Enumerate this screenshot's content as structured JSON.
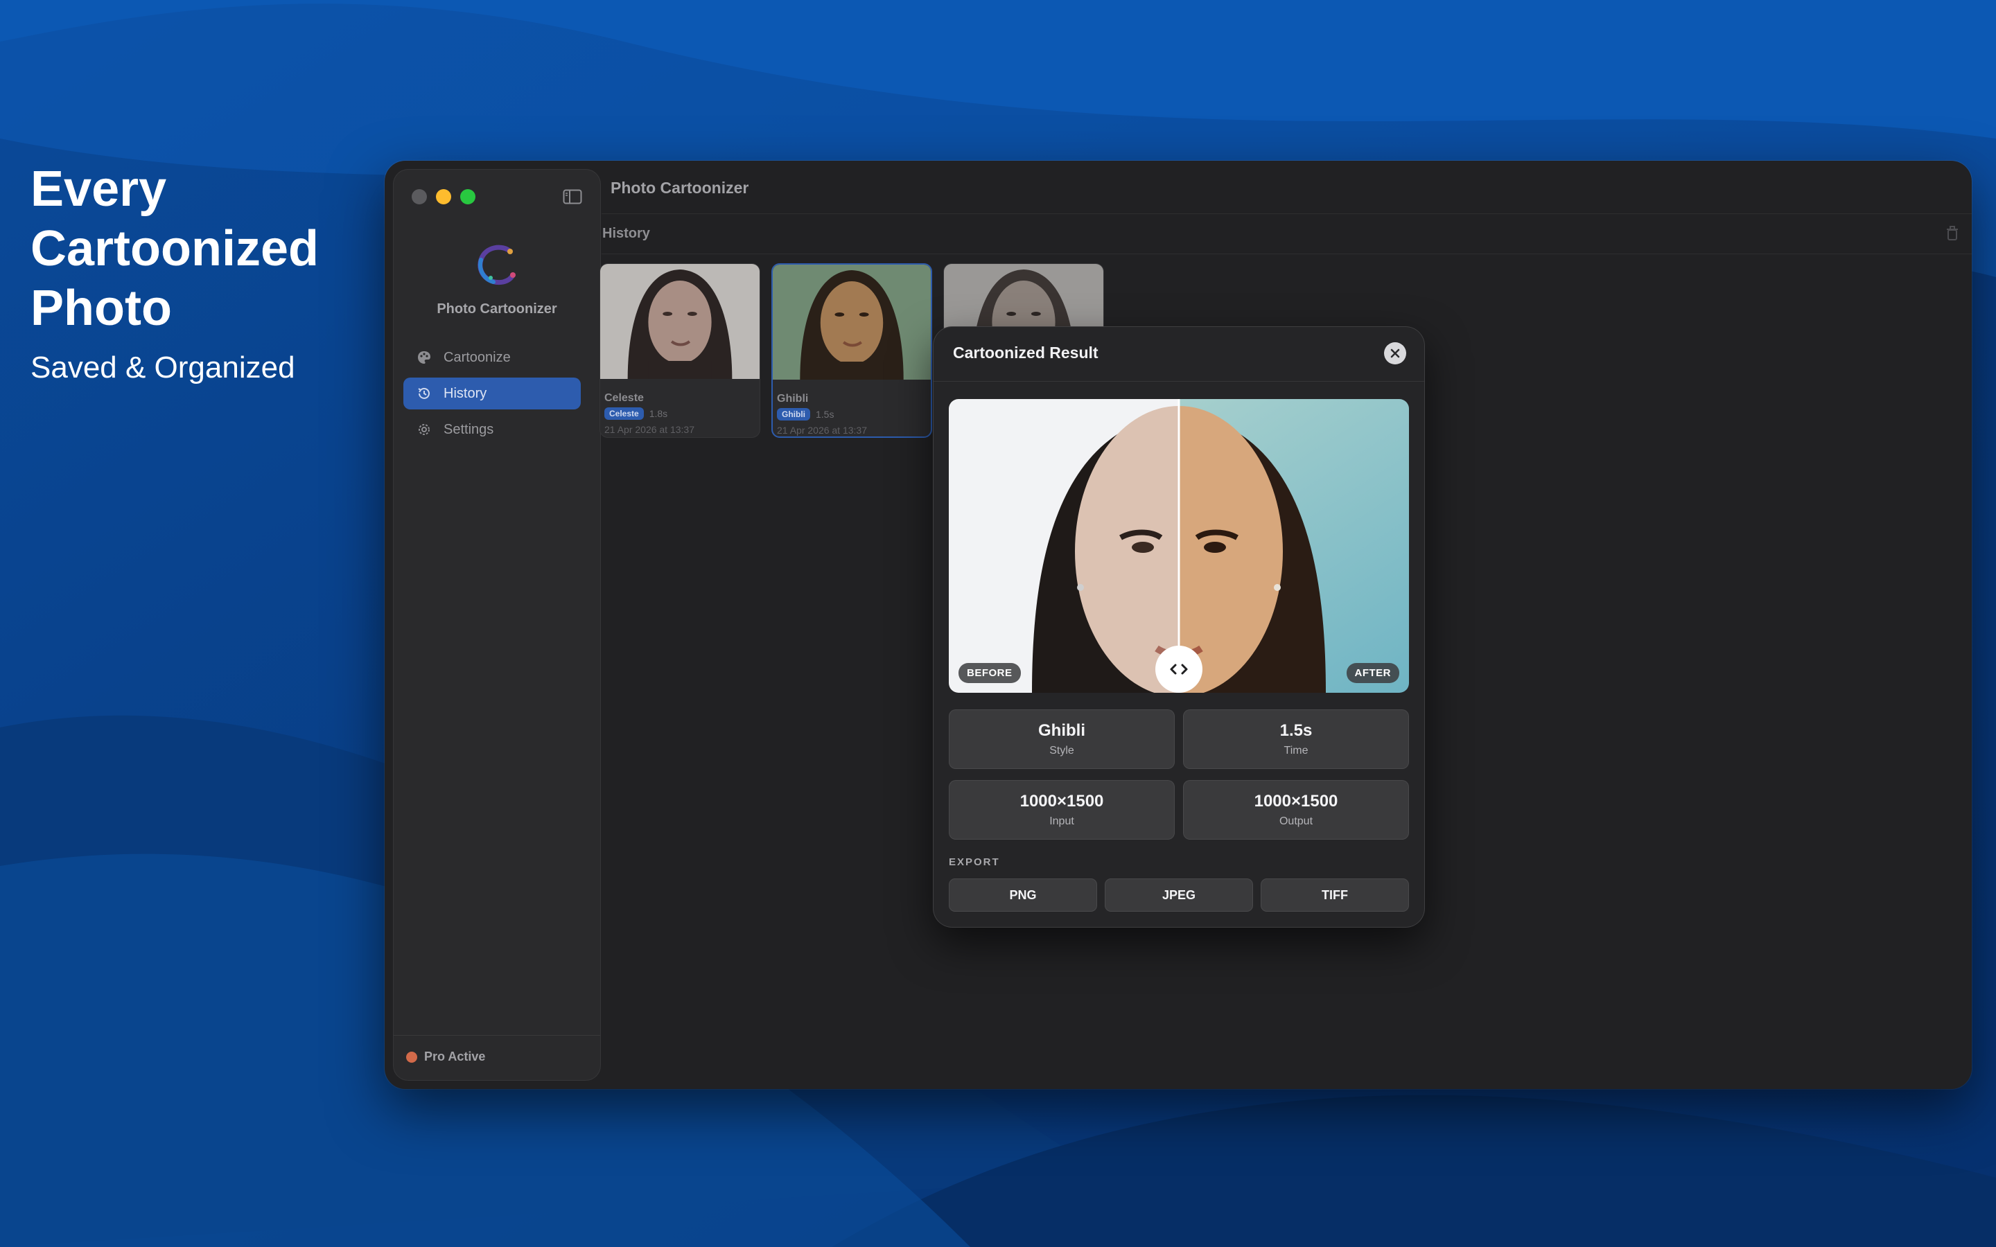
{
  "promo": {
    "headline": [
      "Every",
      "Cartoonized",
      "Photo"
    ],
    "subtitle": "Saved & Organized"
  },
  "window": {
    "title": "Photo Cartoonizer",
    "sidebar": {
      "app_name": "Photo Cartoonizer",
      "items": [
        {
          "label": "Cartoonize",
          "icon": "palette-icon",
          "active": false
        },
        {
          "label": "History",
          "icon": "clock-history-icon",
          "active": true
        },
        {
          "label": "Settings",
          "icon": "gear-icon",
          "active": false
        }
      ],
      "footer": {
        "label": "Pro Active",
        "icon": "pro-badge-icon"
      }
    },
    "history": {
      "section_label": "History",
      "cards": [
        {
          "name": "Celeste",
          "badge": "Celeste",
          "time": "1.8s",
          "date": "21 Apr 2026 at 13:37",
          "selected": false
        },
        {
          "name": "Ghibli",
          "badge": "Ghibli",
          "time": "1.5s",
          "date": "21 Apr 2026 at 13:37",
          "selected": true
        },
        {
          "name": "",
          "badge": "",
          "time": "",
          "date": "",
          "selected": false
        }
      ]
    }
  },
  "modal": {
    "title": "Cartoonized Result",
    "compare": {
      "before_label": "BEFORE",
      "after_label": "AFTER",
      "split_fraction": 0.5
    },
    "stats": [
      {
        "value": "Ghibli",
        "label": "Style"
      },
      {
        "value": "1.5s",
        "label": "Time"
      },
      {
        "value": "1000×1500",
        "label": "Input"
      },
      {
        "value": "1000×1500",
        "label": "Output"
      }
    ],
    "export": {
      "label": "EXPORT",
      "buttons": [
        "PNG",
        "JPEG",
        "TIFF"
      ]
    }
  },
  "colors": {
    "accent": "#2d5cae",
    "background_blue": "#0a3e86",
    "window_bg": "#212123"
  }
}
